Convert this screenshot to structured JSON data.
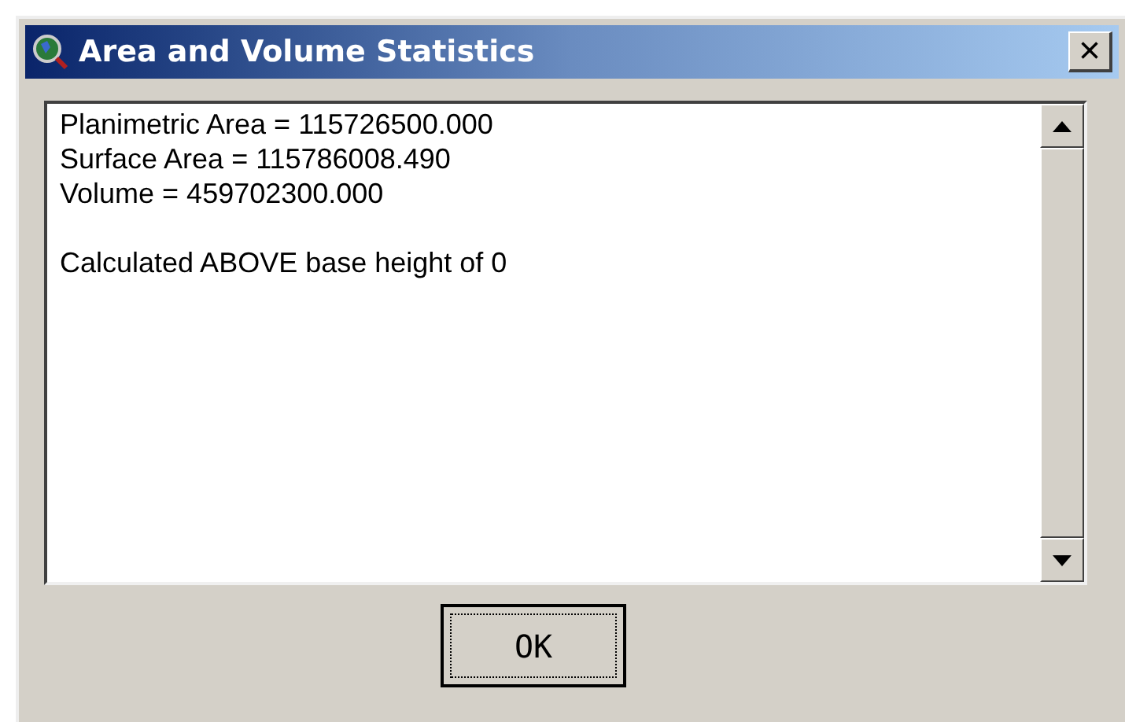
{
  "window": {
    "title": "Area and Volume Statistics",
    "close_label": "×"
  },
  "text_area": {
    "paragraphs": [
      {
        "lines": [
          "Planimetric Area = 115726500.000",
          "Surface Area = 115786008.490",
          "Volume = 459702300.000"
        ]
      },
      {
        "lines": [
          "Calculated ABOVE base height of 0"
        ]
      }
    ]
  },
  "buttons": [
    {
      "label": "OK",
      "focused": true
    }
  ]
}
